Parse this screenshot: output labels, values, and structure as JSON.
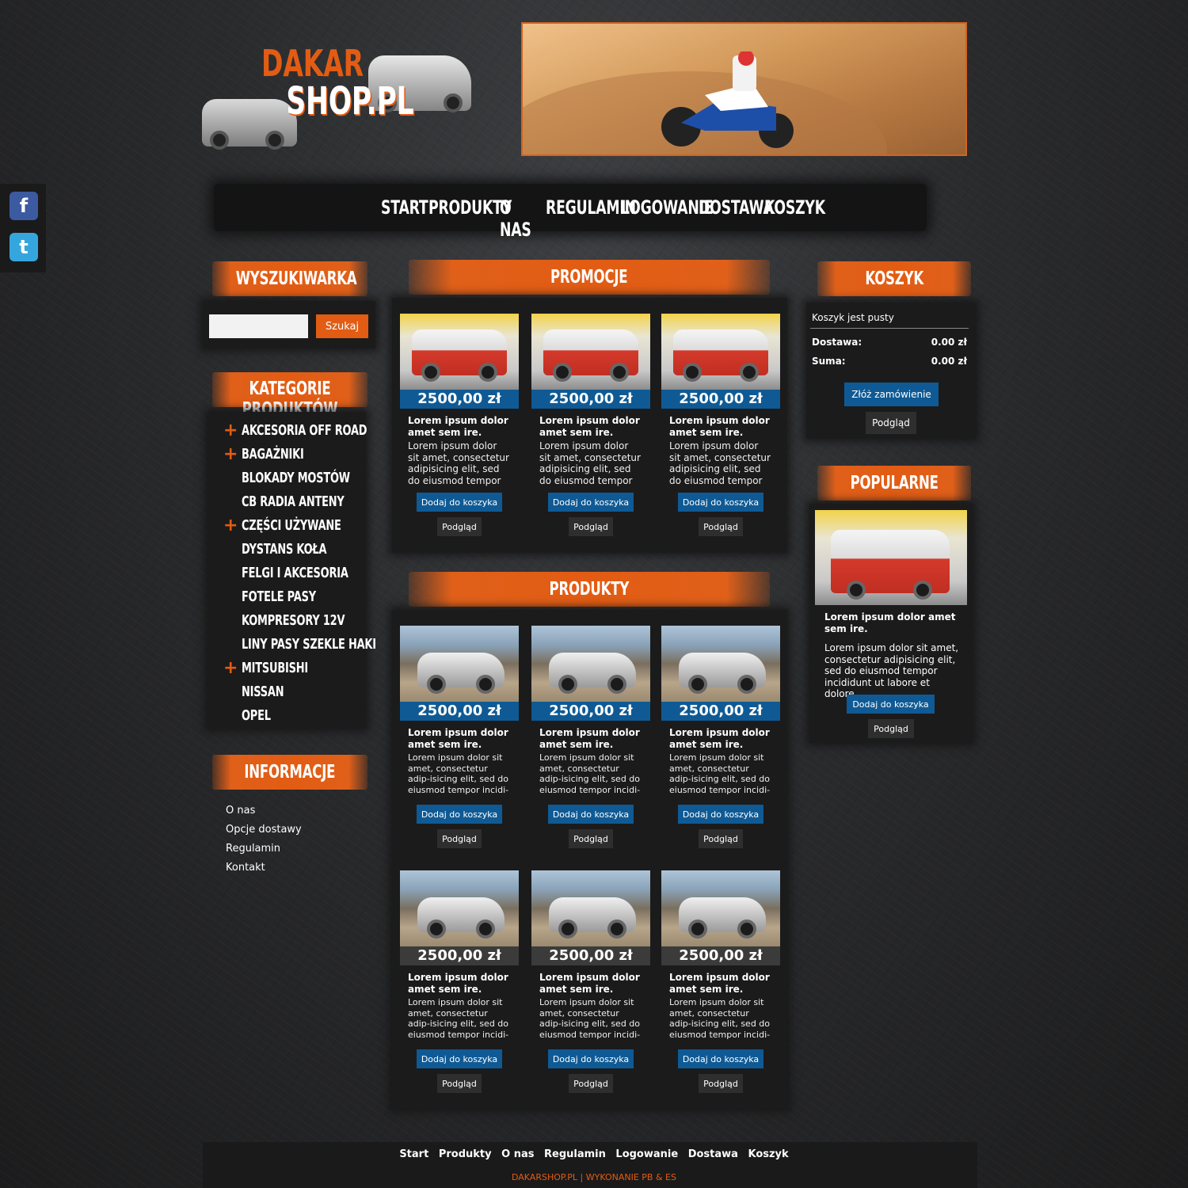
{
  "logo": {
    "line1": "DAKAR",
    "line2": "SHOP.PL"
  },
  "nav": [
    "START",
    "PRODUKTY",
    "O NAS",
    "REGULAMIN",
    "LOGOWANIE",
    "DOSTAWA",
    "KOSZYK"
  ],
  "social": {
    "facebook": "f",
    "twitter": "t"
  },
  "sections": {
    "search": "WYSZUKIWARKA",
    "categories": "KATEGORIE PRODUKTÓW",
    "info": "INFORMACJE",
    "promos": "PROMOCJE",
    "products": "PRODUKTY",
    "cart": "KOSZYK",
    "popular": "POPULARNE"
  },
  "search": {
    "button": "Szukaj",
    "placeholder": ""
  },
  "categories": [
    {
      "label": "AKCESORIA OFF ROAD",
      "expandable": true
    },
    {
      "label": "BAGAŻNIKI",
      "expandable": true
    },
    {
      "label": "BLOKADY MOSTÓW",
      "expandable": false
    },
    {
      "label": "CB RADIA ANTENY",
      "expandable": false
    },
    {
      "label": "CZĘŚCI UŻYWANE",
      "expandable": true
    },
    {
      "label": "DYSTANS KOŁA",
      "expandable": false
    },
    {
      "label": "FELGI I AKCESORIA",
      "expandable": false
    },
    {
      "label": "FOTELE PASY",
      "expandable": false
    },
    {
      "label": "KOMPRESORY 12V",
      "expandable": false
    },
    {
      "label": "LINY PASY SZEKLE HAKI",
      "expandable": false
    },
    {
      "label": "MITSUBISHI",
      "expandable": true
    },
    {
      "label": "NISSAN",
      "expandable": false
    },
    {
      "label": "OPEL",
      "expandable": false
    }
  ],
  "info_links": [
    "O nas",
    "Opcje dostawy",
    "Regulamin",
    "Kontakt"
  ],
  "card_common": {
    "price": "2500,00 zł",
    "title": "Lorem ipsum dolor amet sem ire.",
    "desc_promo": "Lorem ipsum dolor sit amet, consectetur adipisicing elit, sed do eiusmod tempor",
    "desc_prod": "Lorem ipsum dolor sit amet, consectetur adip-isicing elit, sed do eiusmod tempor incidi-",
    "add": "Dodaj do koszyka",
    "view": "Podgląd"
  },
  "cart": {
    "empty": "Koszyk jest pusty",
    "shipping_label": "Dostawa:",
    "shipping_value": "0.00 zł",
    "total_label": "Suma:",
    "total_value": "0.00 zł",
    "order": "Złóż zamówienie",
    "view": "Podgląd"
  },
  "popular": {
    "title": "Lorem ipsum dolor amet sem ire.",
    "desc": "Lorem ipsum dolor sit amet, consectetur adipisicing elit, sed do eiusmod tempor incididunt ut labore et dolore",
    "add": "Dodaj do koszyka",
    "view": "Podgląd"
  },
  "footer": {
    "links": [
      "Start",
      "Produkty",
      "O nas",
      "Regulamin",
      "Logowanie",
      "Dostawa",
      "Koszyk"
    ],
    "copyright": "DAKARSHOP.PL | WYKONANIE PB & ES"
  },
  "colors": {
    "accent": "#e25c13",
    "blue": "#0f5a94"
  }
}
